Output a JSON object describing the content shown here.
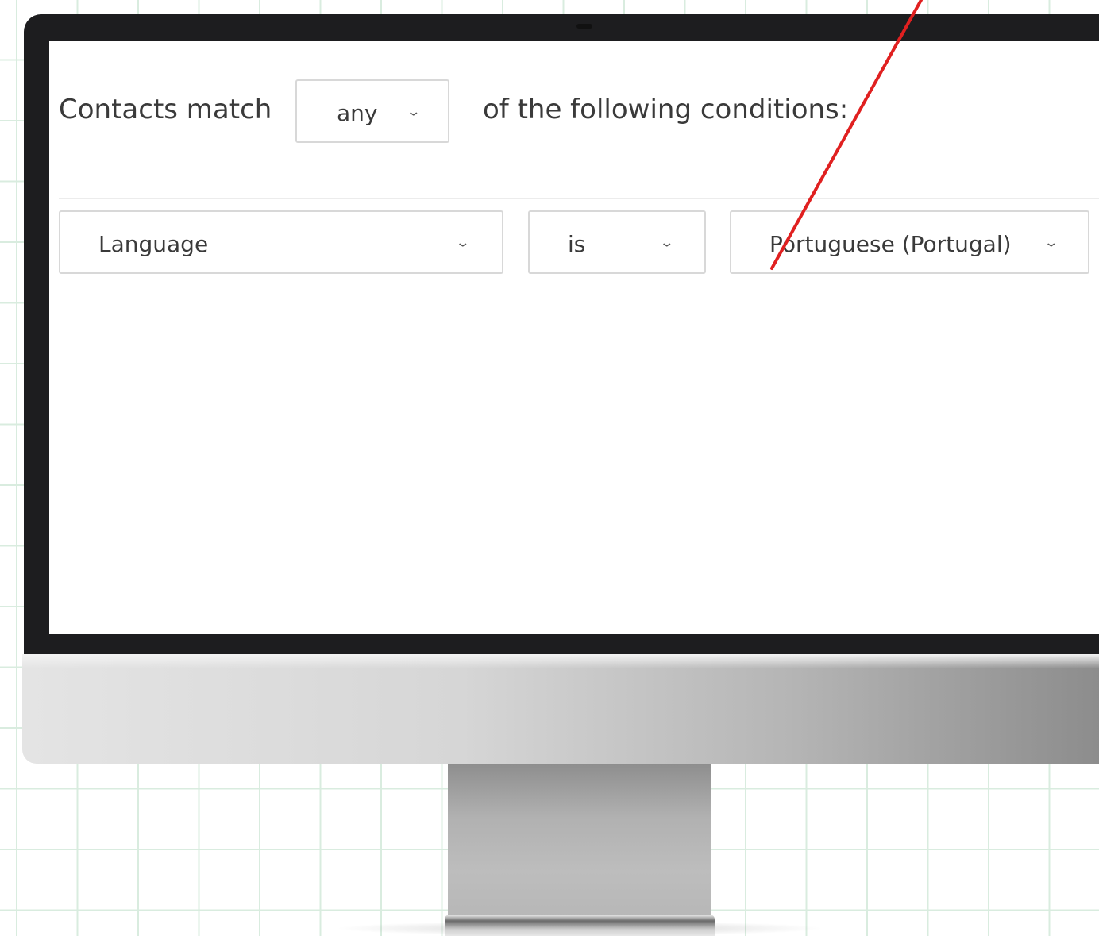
{
  "filter": {
    "prefix_text": "Contacts match",
    "match_mode": "any",
    "suffix_text": "of the following conditions:"
  },
  "condition": {
    "field": "Language",
    "operator": "is",
    "value": "Portuguese (Portugal)"
  },
  "colors": {
    "grid_line": "#d9ecdf",
    "annotation_line": "#e02020",
    "bezel": "#1d1d1f"
  },
  "icons": {
    "dropdown": "chevron-down-icon"
  }
}
